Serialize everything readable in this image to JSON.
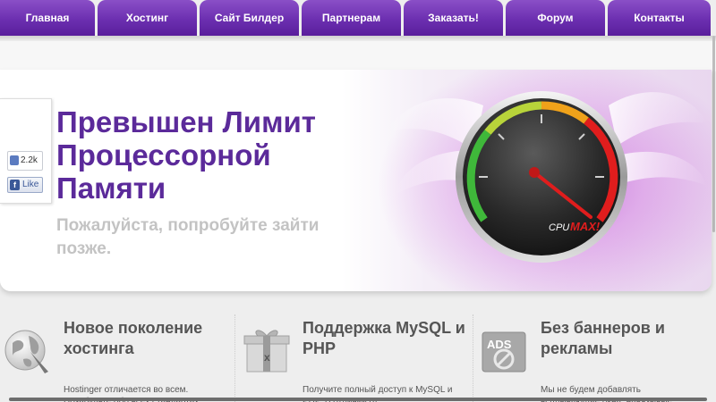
{
  "nav": {
    "tabs": [
      "Главная",
      "Хостинг",
      "Сайт Билдер",
      "Партнерам",
      "Заказать!",
      "Форум",
      "Контакты"
    ]
  },
  "hero": {
    "title": "Превышен Лимит Процессорной Памяти",
    "subtitle": "Пожалуйста, попробуйте зайти позже.",
    "gauge_label_cpu": "CPU",
    "gauge_label_max": "MAX!"
  },
  "like_widget": {
    "count": "2.2k",
    "button_label": "Like"
  },
  "features": [
    {
      "title": "Новое поколение хостинга",
      "text": "Hostinger отличается во всем. Позабудьте обо всех стандартах",
      "icon": "globe-icon"
    },
    {
      "title": "Поддержка MySQL и PHP",
      "text": "Получите полный доступ к MySQL и PHP. В отличии от",
      "icon": "gift-box-icon"
    },
    {
      "title": "Без баннеров и рекламы",
      "text": "Мы не будем добавлять всплывающие окна, навязывые",
      "icon": "no-ads-icon",
      "icon_text": "ADS"
    }
  ],
  "colors": {
    "nav_purple": "#6c2fb0",
    "title_purple": "#5b2a9a",
    "gauge_red": "#e01d1d",
    "gauge_green": "#3fb83a"
  }
}
